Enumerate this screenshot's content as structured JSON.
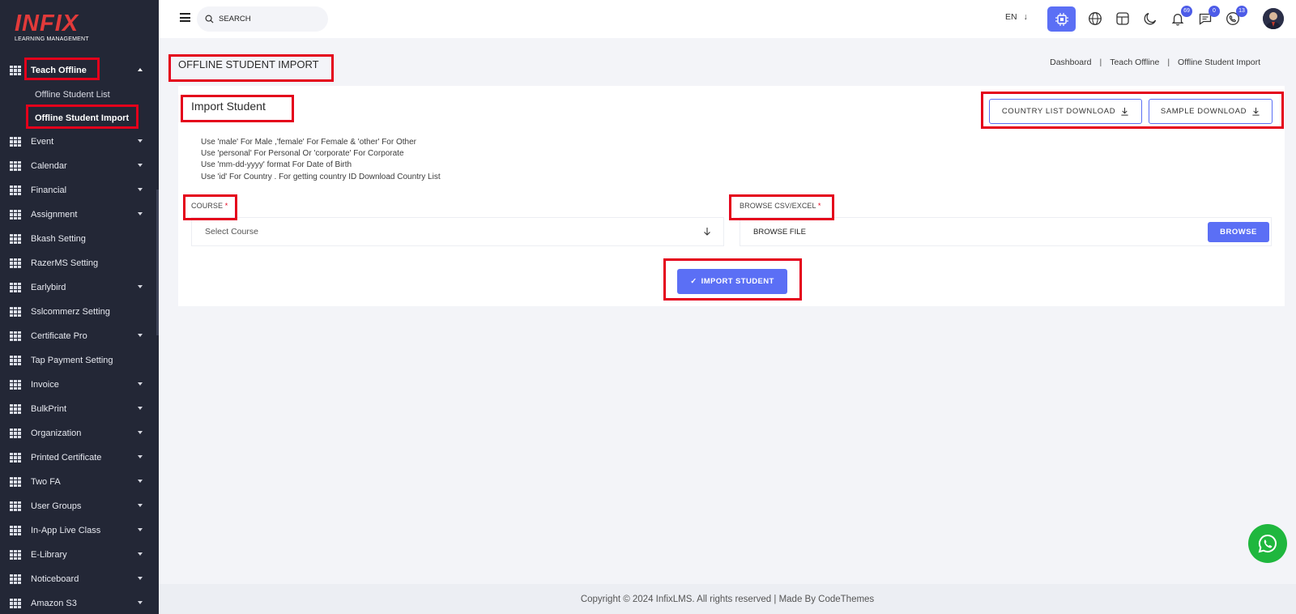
{
  "brand": {
    "name": "INFIX",
    "tagline": "LEARNING MANAGEMENT",
    "color": "#e23a3a"
  },
  "colors": {
    "accent": "#5b6ff5",
    "sidebar": "#232736",
    "highlight": "#e4001b",
    "whatsapp": "#1fb73e"
  },
  "sidebar": {
    "active_section": {
      "label": "Teach Offline",
      "icon": "grid-icon",
      "expanded": true
    },
    "sub_items": [
      {
        "label": "Offline Student List",
        "active": false
      },
      {
        "label": "Offline Student Import",
        "active": true
      }
    ],
    "items": [
      {
        "label": "Event",
        "has_caret": true
      },
      {
        "label": "Calendar",
        "has_caret": true
      },
      {
        "label": "Financial",
        "has_caret": true
      },
      {
        "label": "Assignment",
        "has_caret": true
      },
      {
        "label": "Bkash Setting",
        "has_caret": false
      },
      {
        "label": "RazerMS Setting",
        "has_caret": false
      },
      {
        "label": "Earlybird",
        "has_caret": true
      },
      {
        "label": "Sslcommerz Setting",
        "has_caret": false
      },
      {
        "label": "Certificate Pro",
        "has_caret": true
      },
      {
        "label": "Tap Payment Setting",
        "has_caret": false
      },
      {
        "label": "Invoice",
        "has_caret": true
      },
      {
        "label": "BulkPrint",
        "has_caret": true
      },
      {
        "label": "Organization",
        "has_caret": true
      },
      {
        "label": "Printed Certificate",
        "has_caret": true
      },
      {
        "label": "Two FA",
        "has_caret": true
      },
      {
        "label": "User Groups",
        "has_caret": true
      },
      {
        "label": "In-App Live Class",
        "has_caret": true
      },
      {
        "label": "E-Library",
        "has_caret": true
      },
      {
        "label": "Noticeboard",
        "has_caret": true
      },
      {
        "label": "Amazon S3",
        "has_caret": true
      }
    ]
  },
  "topbar": {
    "search_placeholder": "SEARCH",
    "language": "EN",
    "icons": [
      "menu-icon",
      "chip-icon",
      "globe-icon",
      "layout-icon",
      "moon-icon",
      "bell-icon",
      "chat-icon",
      "phone-icon"
    ],
    "badges": {
      "notifications": "69",
      "messages": "0",
      "calls": "13"
    }
  },
  "page": {
    "title": "OFFLINE STUDENT IMPORT",
    "breadcrumb": [
      "Dashboard",
      "Teach Offline",
      "Offline Student Import"
    ],
    "breadcrumb_separator": "|"
  },
  "card": {
    "title": "Import Student",
    "country_download": "COUNTRY LIST DOWNLOAD",
    "sample_download": "SAMPLE DOWNLOAD",
    "notes": [
      "Use 'male' For Male ,'female' For Female & 'other' For Other",
      "Use 'personal' For Personal Or 'corporate' For Corporate",
      "Use 'mm-dd-yyyy' format For Date of Birth",
      "Use 'id' For Country . For getting country ID Download Country List"
    ],
    "course_label": "COURSE",
    "course_required": "*",
    "course_placeholder": "Select Course",
    "file_label": "BROWSE CSV/EXCEL",
    "file_required": "*",
    "file_placeholder": "BROWSE FILE",
    "browse_button": "BROWSE",
    "import_button": "IMPORT STUDENT",
    "import_check": "✓"
  },
  "footer": {
    "text": "Copyright © 2024 InfixLMS. All rights reserved | Made By CodeThemes"
  }
}
